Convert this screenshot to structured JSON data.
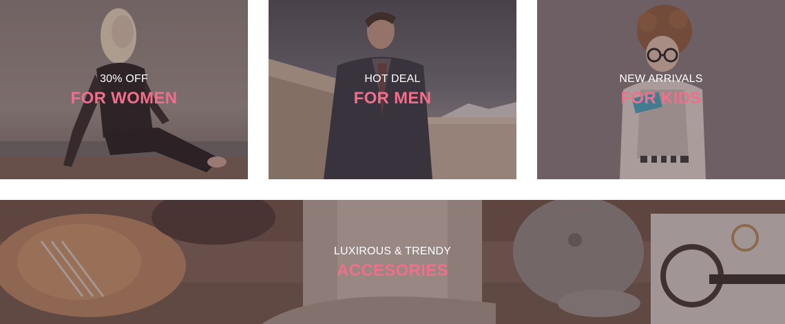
{
  "banners": {
    "women": {
      "kicker": "30% OFF",
      "headline": "FOR WOMEN"
    },
    "men": {
      "kicker": "HOT DEAL",
      "headline": "FOR MEN"
    },
    "kids": {
      "kicker": "NEW ARRIVALS",
      "headline": "FOR KIDS"
    },
    "accessories": {
      "kicker": "LUXIROUS & TRENDY",
      "headline": "ACCESORIES"
    }
  },
  "colors": {
    "headline": "#f26e8b",
    "kicker": "#ffffff",
    "overlay": "#4a343a"
  }
}
